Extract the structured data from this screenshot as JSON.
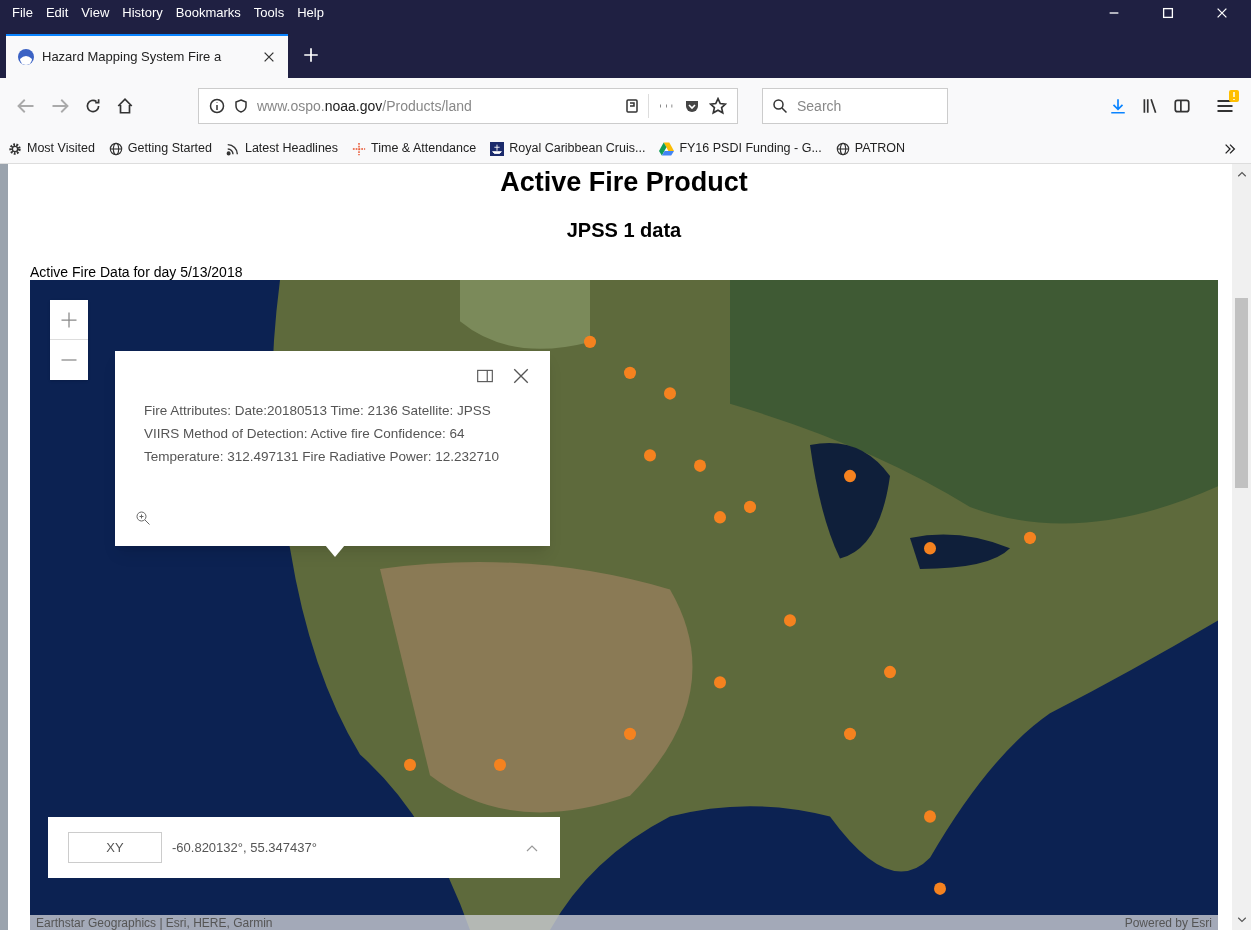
{
  "menu_bar": [
    "File",
    "Edit",
    "View",
    "History",
    "Bookmarks",
    "Tools",
    "Help"
  ],
  "tabs": [
    {
      "label": "Hazard Mapping System Fire a",
      "selected": true
    }
  ],
  "address_bar": {
    "url": "www.ospo.**noaa.gov**/Products/land"
  },
  "search": {
    "placeholder": "Search"
  },
  "bookmarks": [
    {
      "kind": "gear",
      "label": "Most Visited"
    },
    {
      "kind": "globe",
      "label": "Getting Started"
    },
    {
      "kind": "feed",
      "label": "Latest Headlines"
    },
    {
      "kind": "cross",
      "label": "Time & Attendance"
    },
    {
      "kind": "ship",
      "label": "Royal Caribbean Cruis..."
    },
    {
      "kind": "drive",
      "label": "FY16 PSDI Funding - G..."
    },
    {
      "kind": "globe",
      "label": "PATRON"
    }
  ],
  "page": {
    "title": "Active Fire Product",
    "subtitle": "JPSS 1 data",
    "caption": "Active Fire Data for day 5/13/2018",
    "map": {
      "popup": {
        "text": "Fire Attributes: Date:20180513 Time: 2136 Satellite: JPSS VIIRS Method of Detection: Active fire Confidence: 64 Temperature: 312.497131 Fire Radiative Power: 12.232710"
      },
      "coordinates": {
        "button": "XY",
        "value": "-60.820132°, 55.347437°"
      },
      "attribution": "Earthstar Geographics | Esri, HERE, Garmin",
      "powered_by": "Powered by Esri"
    }
  }
}
